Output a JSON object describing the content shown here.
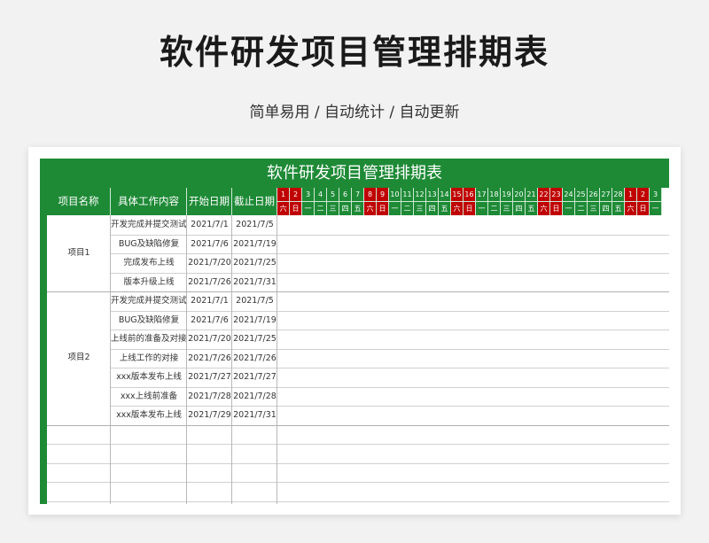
{
  "page": {
    "title": "软件研发项目管理排期表",
    "subtitle": "简单易用 / 自动统计 / 自动更新"
  },
  "sheet": {
    "title": "软件研发项目管理排期表",
    "headers": {
      "project": "项目名称",
      "task": "具体工作内容",
      "start": "开始日期",
      "end": "截止日期"
    },
    "days": [
      {
        "d": "1",
        "w": "六",
        "weekend": true
      },
      {
        "d": "2",
        "w": "日",
        "weekend": true
      },
      {
        "d": "3",
        "w": "一",
        "weekend": false
      },
      {
        "d": "4",
        "w": "二",
        "weekend": false
      },
      {
        "d": "5",
        "w": "三",
        "weekend": false
      },
      {
        "d": "6",
        "w": "四",
        "weekend": false
      },
      {
        "d": "7",
        "w": "五",
        "weekend": false
      },
      {
        "d": "8",
        "w": "六",
        "weekend": true
      },
      {
        "d": "9",
        "w": "日",
        "weekend": true
      },
      {
        "d": "10",
        "w": "一",
        "weekend": false
      },
      {
        "d": "11",
        "w": "二",
        "weekend": false
      },
      {
        "d": "12",
        "w": "三",
        "weekend": false
      },
      {
        "d": "13",
        "w": "四",
        "weekend": false
      },
      {
        "d": "14",
        "w": "五",
        "weekend": false
      },
      {
        "d": "15",
        "w": "六",
        "weekend": true
      },
      {
        "d": "16",
        "w": "日",
        "weekend": true
      },
      {
        "d": "17",
        "w": "一",
        "weekend": false
      },
      {
        "d": "18",
        "w": "二",
        "weekend": false
      },
      {
        "d": "19",
        "w": "三",
        "weekend": false
      },
      {
        "d": "20",
        "w": "四",
        "weekend": false
      },
      {
        "d": "21",
        "w": "五",
        "weekend": false
      },
      {
        "d": "22",
        "w": "六",
        "weekend": true
      },
      {
        "d": "23",
        "w": "日",
        "weekend": true
      },
      {
        "d": "24",
        "w": "一",
        "weekend": false
      },
      {
        "d": "25",
        "w": "二",
        "weekend": false
      },
      {
        "d": "26",
        "w": "三",
        "weekend": false
      },
      {
        "d": "27",
        "w": "四",
        "weekend": false
      },
      {
        "d": "28",
        "w": "五",
        "weekend": false
      },
      {
        "d": "1",
        "w": "六",
        "weekend": true
      },
      {
        "d": "2",
        "w": "日",
        "weekend": true
      },
      {
        "d": "3",
        "w": "一",
        "weekend": false
      }
    ],
    "projects": [
      {
        "name": "项目1",
        "tasks": [
          {
            "task": "开发完成并提交测试版本",
            "start": "2021/7/1",
            "end": "2021/7/5"
          },
          {
            "task": "BUG及缺陷修复",
            "start": "2021/7/6",
            "end": "2021/7/19"
          },
          {
            "task": "完成发布上线",
            "start": "2021/7/20",
            "end": "2021/7/25"
          },
          {
            "task": "版本升级上线",
            "start": "2021/7/26",
            "end": "2021/7/31"
          }
        ]
      },
      {
        "name": "项目2",
        "tasks": [
          {
            "task": "开发完成并提交测试版本",
            "start": "2021/7/1",
            "end": "2021/7/5"
          },
          {
            "task": "BUG及缺陷修复",
            "start": "2021/7/6",
            "end": "2021/7/19"
          },
          {
            "task": "上线前的准备及对接工作",
            "start": "2021/7/20",
            "end": "2021/7/25"
          },
          {
            "task": "上线工作的对接",
            "start": "2021/7/26",
            "end": "2021/7/26"
          },
          {
            "task": "xxx版本发布上线",
            "start": "2021/7/27",
            "end": "2021/7/27"
          },
          {
            "task": "xxx上线前准备",
            "start": "2021/7/28",
            "end": "2021/7/28"
          },
          {
            "task": "xxx版本发布上线",
            "start": "2021/7/29",
            "end": "2021/7/31"
          }
        ]
      }
    ]
  },
  "colors": {
    "header_green": "#1e8a36",
    "weekend_red": "#c00000"
  }
}
